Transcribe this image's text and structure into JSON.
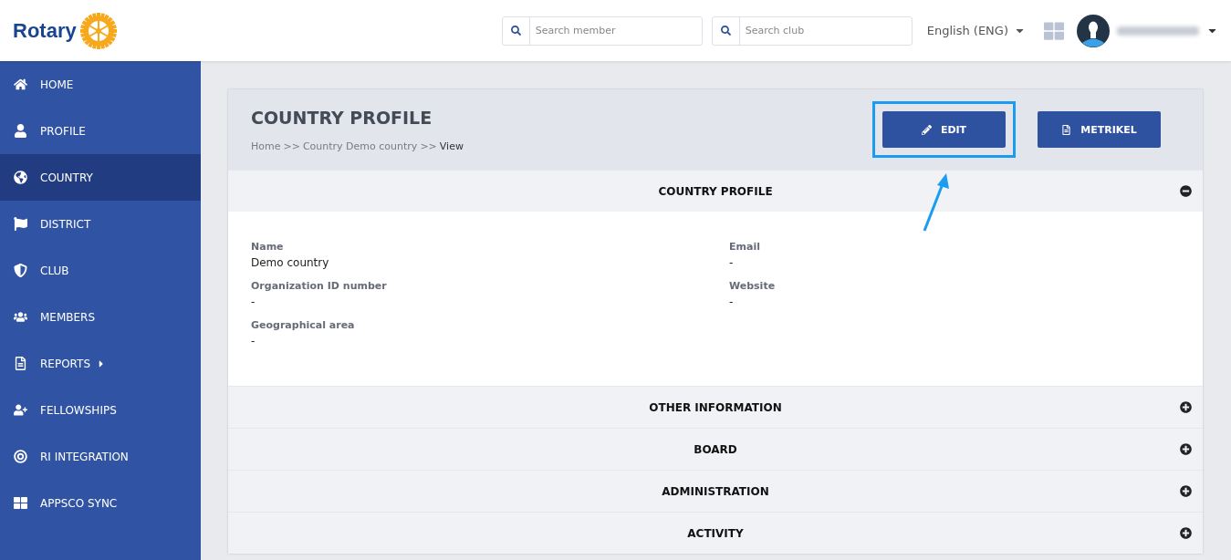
{
  "header": {
    "logo_text": "Rotary",
    "search_member": {
      "placeholder": "Search member"
    },
    "search_club": {
      "placeholder": "Search club"
    },
    "language": "English (ENG)"
  },
  "sidebar": {
    "items": [
      {
        "label": "HOME",
        "selected": false
      },
      {
        "label": "PROFILE",
        "selected": false
      },
      {
        "label": "COUNTRY",
        "selected": true
      },
      {
        "label": "DISTRICT",
        "selected": false
      },
      {
        "label": "CLUB",
        "selected": false
      },
      {
        "label": "MEMBERS",
        "selected": false
      },
      {
        "label": "REPORTS",
        "selected": false,
        "submenu": true
      },
      {
        "label": "FELLOWSHIPS",
        "selected": false
      },
      {
        "label": "RI INTEGRATION",
        "selected": false
      },
      {
        "label": "APPSCO SYNC",
        "selected": false
      }
    ]
  },
  "page": {
    "title": "COUNTRY PROFILE",
    "breadcrumb": [
      {
        "text": "Home",
        "kind": "link"
      },
      {
        "text": ">>",
        "kind": "separator"
      },
      {
        "text": "Country Demo country",
        "kind": "link"
      },
      {
        "text": ">>",
        "kind": "separator"
      },
      {
        "text": "View",
        "kind": "current"
      }
    ],
    "buttons": [
      {
        "label": "EDIT",
        "highlighted": true
      },
      {
        "label": "METRIKEL",
        "highlighted": false
      }
    ],
    "sections": [
      {
        "title": "COUNTRY PROFILE",
        "expanded": true,
        "fields": [
          {
            "label": "Name",
            "value": "Demo country"
          },
          {
            "label": "Email",
            "value": "-"
          },
          {
            "label": "Organization ID number",
            "value": "-"
          },
          {
            "label": "Website",
            "value": "-"
          },
          {
            "label": "Geographical area",
            "value": "-"
          }
        ]
      },
      {
        "title": "OTHER INFORMATION",
        "expanded": false
      },
      {
        "title": "BOARD",
        "expanded": false
      },
      {
        "title": "ADMINISTRATION",
        "expanded": false
      },
      {
        "title": "ACTIVITY",
        "expanded": false
      }
    ]
  }
}
